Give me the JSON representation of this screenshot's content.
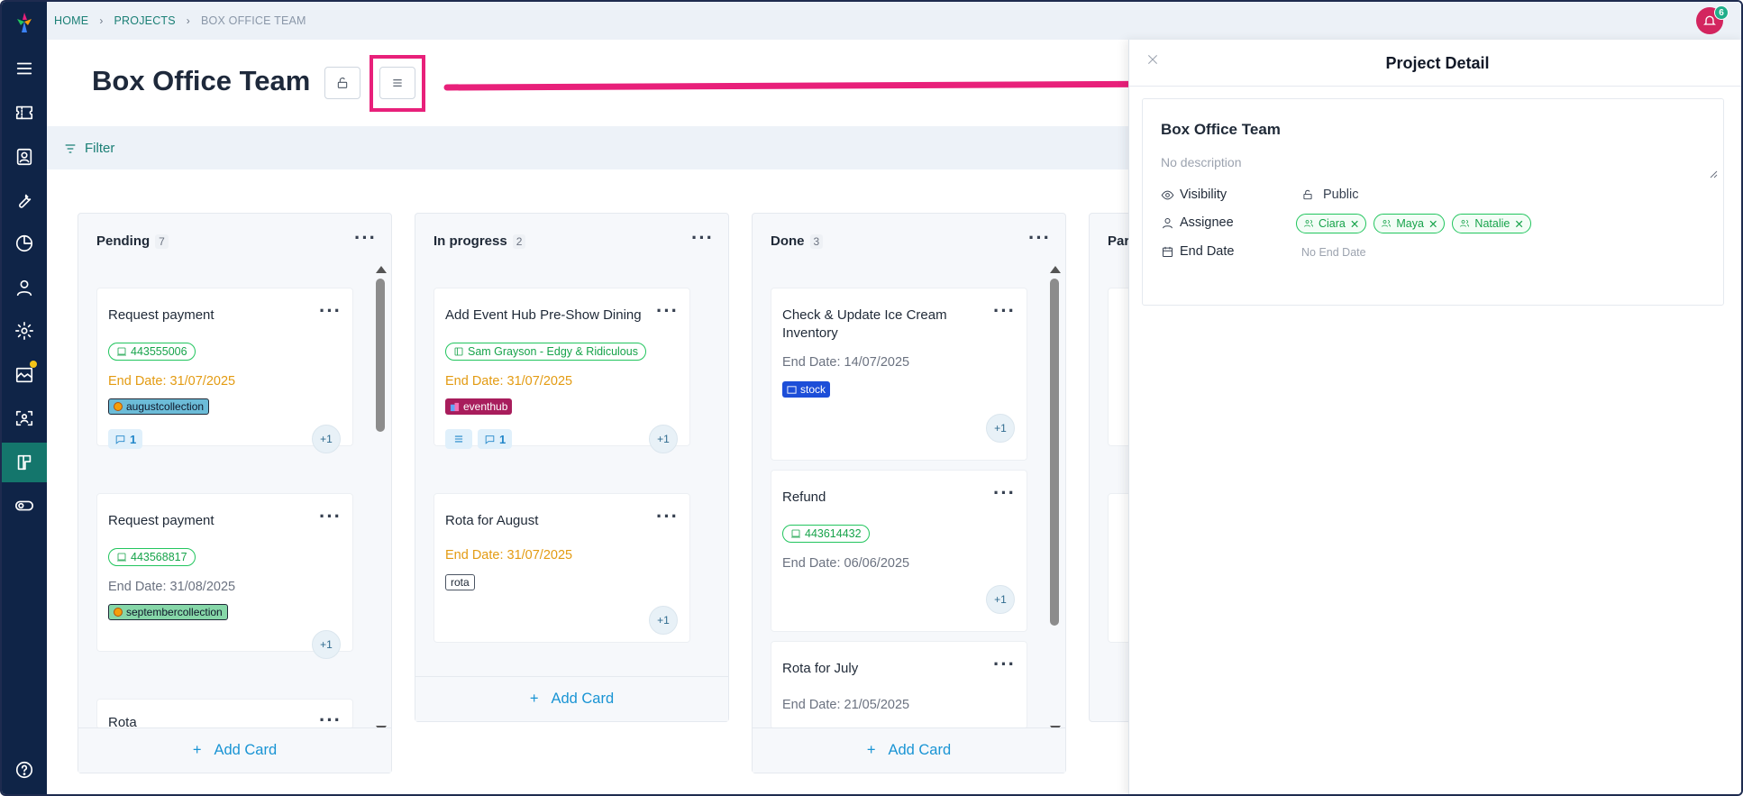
{
  "breadcrumb": {
    "home": "HOME",
    "projects": "PROJECTS",
    "current": "BOX OFFICE TEAM"
  },
  "notifications": {
    "count": "6"
  },
  "page": {
    "title": "Box Office Team"
  },
  "filter": {
    "label": "Filter"
  },
  "add_card_label": "Add Card",
  "columns": [
    {
      "name": "Pending",
      "count": "7",
      "cards": [
        {
          "title": "Request payment",
          "chip": "443555006",
          "end": "End Date: 31/07/2025",
          "tag": "augustcollection",
          "comments": "1",
          "plus": "+1"
        },
        {
          "title": "Request payment",
          "chip": "443568817",
          "end": "End Date: 31/08/2025",
          "tag": "septembercollection",
          "plus": "+1"
        },
        {
          "title": "Rota"
        }
      ]
    },
    {
      "name": "In progress",
      "count": "2",
      "cards": [
        {
          "title": "Add Event Hub Pre-Show Dining",
          "chip": "Sam Grayson - Edgy & Ridiculous",
          "end": "End Date: 31/07/2025",
          "tag": "eventhub",
          "comments": "1",
          "plus": "+1"
        },
        {
          "title": "Rota for August",
          "end": "End Date: 31/07/2025",
          "tag": "rota",
          "plus": "+1"
        }
      ]
    },
    {
      "name": "Done",
      "count": "3",
      "cards": [
        {
          "title": "Check & Update Ice Cream Inventory",
          "end": "End Date: 14/07/2025",
          "tag": "stock",
          "plus": "+1"
        },
        {
          "title": "Refund",
          "chip": "443614432",
          "end": "End Date: 06/06/2025",
          "plus": "+1"
        },
        {
          "title": "Rota for July",
          "end": "End Date: 21/05/2025"
        }
      ]
    },
    {
      "name": "Par"
    }
  ],
  "detail": {
    "heading": "Project Detail",
    "name": "Box Office Team",
    "description_placeholder": "No description",
    "visibility_label": "Visibility",
    "visibility_value": "Public",
    "assignee_label": "Assignee",
    "assignees": [
      "Ciara",
      "Maya",
      "Natalie"
    ],
    "end_date_label": "End Date",
    "end_date_value": "No End Date"
  },
  "colors": {
    "sidebar": "#0f2447",
    "accent": "#1a7f75",
    "highlight": "#e8207a",
    "link_blue": "#1994d4"
  }
}
